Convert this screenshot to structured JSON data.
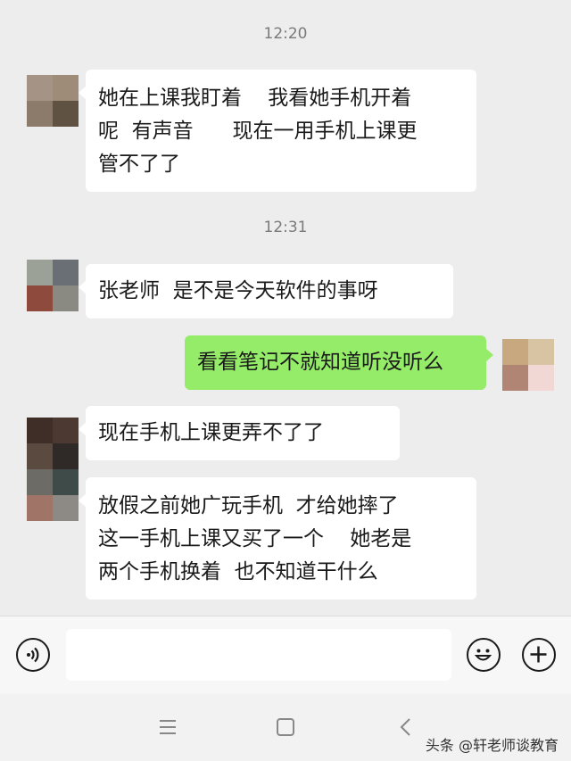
{
  "chat": {
    "timestamps": [
      "12:20",
      "12:31"
    ],
    "messages": [
      {
        "side": "left",
        "text": "她在上课我盯着    我看她手机开着\n呢  有声音      现在一用手机上课更\n管不了了"
      },
      {
        "side": "left",
        "text": "张老师  是不是今天软件的事呀"
      },
      {
        "side": "right",
        "text": "看看笔记不就知道听没听么"
      },
      {
        "side": "left",
        "text": "现在手机上课更弄不了了"
      },
      {
        "side": "left",
        "text": "放假之前她广玩手机  才给她摔了\n这一手机上课又买了一个    她老是\n两个手机换着  也不知道干什么"
      }
    ]
  },
  "input_bar": {
    "voice_icon": "voice-icon",
    "emoji_icon": "emoji-icon",
    "add_icon": "plus-icon",
    "placeholder": ""
  },
  "nav_bar": {
    "icons": [
      "menu-icon",
      "home-square-icon",
      "back-chevron-icon"
    ]
  },
  "watermark": "头条 @轩老师谈教育",
  "colors": {
    "background": "#ededed",
    "bubble_other": "#ffffff",
    "bubble_self": "#95ec69",
    "timestamp": "#7a7a7a"
  }
}
